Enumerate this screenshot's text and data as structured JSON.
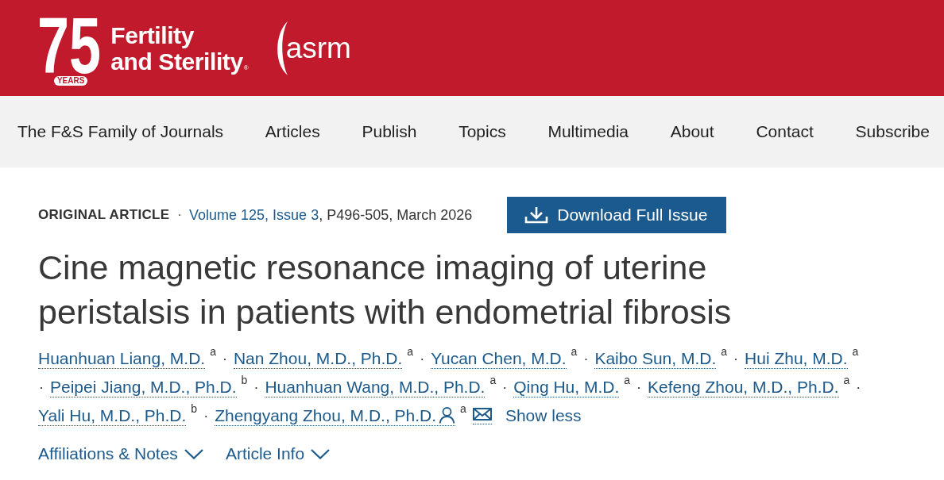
{
  "header": {
    "logo": {
      "number": "75",
      "badge": "YEARS",
      "title_lines": [
        "Fertility",
        "and Sterility"
      ],
      "mark": "®"
    },
    "partner_logo": {
      "text": "asrm"
    }
  },
  "nav": {
    "items": [
      {
        "label": "The F&S Family of Journals"
      },
      {
        "label": "Articles"
      },
      {
        "label": "Publish"
      },
      {
        "label": "Topics"
      },
      {
        "label": "Multimedia"
      },
      {
        "label": "About"
      },
      {
        "label": "Contact"
      },
      {
        "label": "Subscribe"
      }
    ]
  },
  "article": {
    "type": "ORIGINAL ARTICLE",
    "separator": "·",
    "issue_link": "Volume 125, Issue 3",
    "pages_date": ", P496-505, March 2026",
    "download_button": "Download Full Issue",
    "title": "Cine magnetic resonance imaging of uterine peristalsis in patients with endometrial fibrosis",
    "author_lines": [
      [
        {
          "kind": "author",
          "name": "Huanhuan Liang, M.D.",
          "affiliation": "a",
          "corresponding": false
        },
        {
          "kind": "separator",
          "text": "·"
        },
        {
          "kind": "author",
          "name": "Nan Zhou, M.D., Ph.D.",
          "affiliation": "a",
          "corresponding": false
        },
        {
          "kind": "separator",
          "text": "·"
        },
        {
          "kind": "author",
          "name": "Yucan Chen, M.D.",
          "affiliation": "a",
          "corresponding": false
        },
        {
          "kind": "separator",
          "text": "·"
        },
        {
          "kind": "author",
          "name": "Kaibo Sun, M.D.",
          "affiliation": "a",
          "corresponding": false
        },
        {
          "kind": "separator",
          "text": "·"
        },
        {
          "kind": "author",
          "name": "Hui Zhu, M.D.",
          "affiliation": "a",
          "corresponding": false
        }
      ],
      [
        {
          "kind": "separator",
          "text": "·"
        },
        {
          "kind": "author",
          "name": "Peipei Jiang, M.D., Ph.D.",
          "affiliation": "b",
          "corresponding": false
        },
        {
          "kind": "separator",
          "text": "·"
        },
        {
          "kind": "author",
          "name": "Huanhuan Wang, M.D., Ph.D.",
          "affiliation": "a",
          "corresponding": false
        },
        {
          "kind": "separator",
          "text": "·"
        },
        {
          "kind": "author",
          "name": "Qing Hu, M.D.",
          "affiliation": "a",
          "corresponding": false
        },
        {
          "kind": "separator",
          "text": "·"
        },
        {
          "kind": "author",
          "name": "Kefeng Zhou, M.D., Ph.D.",
          "affiliation": "a",
          "corresponding": false
        },
        {
          "kind": "separator",
          "text": "·"
        }
      ],
      [
        {
          "kind": "author",
          "name": "Yali Hu, M.D., Ph.D.",
          "affiliation": "b",
          "corresponding": false
        },
        {
          "kind": "separator",
          "text": "·"
        },
        {
          "kind": "author",
          "name": "Zhengyang Zhou, M.D., Ph.D.",
          "affiliation": "a",
          "corresponding": true
        },
        {
          "kind": "email"
        },
        {
          "kind": "toggle",
          "label": "Show less"
        }
      ]
    ],
    "toggles": [
      {
        "label": "Affiliations & Notes",
        "expanded": false
      },
      {
        "label": "Article Info",
        "expanded": false
      }
    ]
  }
}
